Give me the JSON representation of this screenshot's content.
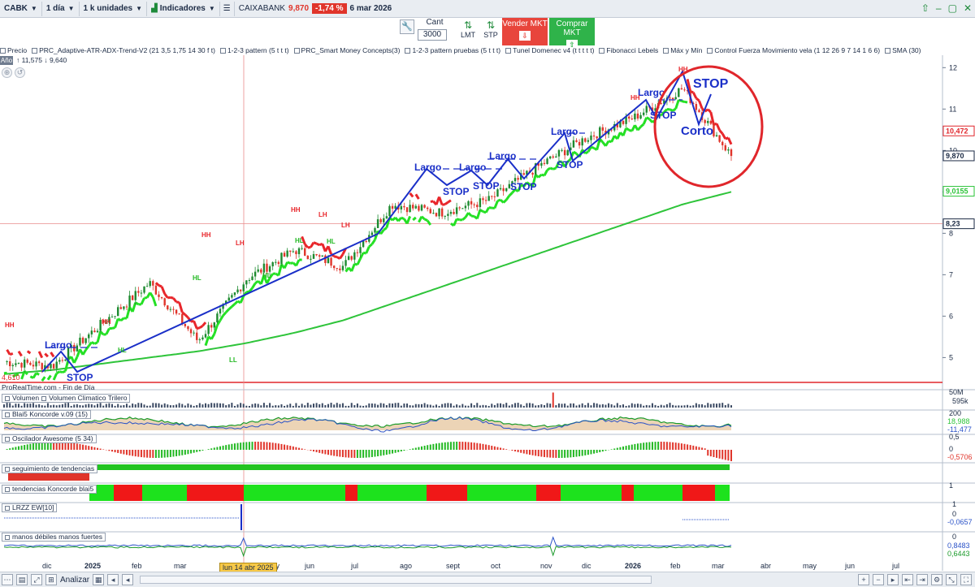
{
  "toolbar": {
    "symbol": "CABK",
    "timeframe": "1 día",
    "units": "1 k unidades",
    "indicators_label": "Indicadores",
    "instrument": "CAIXABANK",
    "last_price": "9,870",
    "change": "-1,74 %",
    "date": "6 mar 2026"
  },
  "order_panel": {
    "qty_label": "Cant",
    "qty_value": "3000",
    "lmt_label": "LMT",
    "stp_label": "STP",
    "sell_label": "Vender MKT",
    "buy_label": "Comprar MKT"
  },
  "indicator_bar": [
    "Precio",
    "PRC_Adaptive-ATR-ADX-Trend-V2 (21 3,5 1,75 14 30 f t)",
    "1-2-3 pattern (5 t t t)",
    "PRC_Smart Money Concepts(3)",
    "1-2-3 pattern pruebas (5 t t t)",
    "Tunel Domenec v4 (t t t t t)",
    "Fibonacci Lebels",
    "Máx y Mín",
    "Control Fuerza Movimiento vela (1 12 26 9 7 14 1 6 6)",
    "SMA (30)"
  ],
  "period_label": "Año",
  "price_range": "↑ 11,575 ↓ 9,640",
  "price_axis": [
    "12",
    "11",
    "10",
    "9",
    "8",
    "7",
    "6",
    "5"
  ],
  "price_tags": {
    "high": "10,472",
    "last": "9,870",
    "sma": "9,0155",
    "fib": "8,23",
    "low_line": "4,610"
  },
  "source_label": "ProRealTime.com - Fin de Día",
  "panels": {
    "volume": {
      "label1": "Volumen",
      "label2": "Volumen Climatico Trilero",
      "axis_top": "50M",
      "value": "595k"
    },
    "koncorde": {
      "label": "Blai5 Koncorde v.09 (15)",
      "axis": [
        "200",
        "18,988",
        "-11,477"
      ]
    },
    "awesome": {
      "label": "Oscilador Awesome (5 34)",
      "axis": [
        "0,5",
        "0",
        "-0,5706"
      ]
    },
    "trend_follow": {
      "label": "seguimiento de tendencias"
    },
    "trend_koncorde": {
      "label": "tendencias Koncorde blai5",
      "axis": [
        "1"
      ]
    },
    "lrzz": {
      "label": "LRZZ EW[10]",
      "axis": [
        "1",
        "0",
        "-0,0657"
      ]
    },
    "weak_strong": {
      "label": "manos débiles  manos fuertes",
      "axis": [
        "0",
        "0,8483",
        "0,6443"
      ]
    }
  },
  "annotations": {
    "largo": "Largo",
    "stop": "STOP",
    "corto": "Corto",
    "hh": "HH",
    "hl": "HL",
    "lh": "LH",
    "ll": "LL"
  },
  "x_axis": [
    "dic",
    "2025",
    "feb",
    "mar",
    "abr",
    "may",
    "jun",
    "jul",
    "ago",
    "sept",
    "oct",
    "nov",
    "dic",
    "2026",
    "feb",
    "mar",
    "abr",
    "may",
    "jun",
    "jul"
  ],
  "date_hover": "lun 14 abr 2025",
  "bottom": {
    "analyze": "Analizar"
  },
  "colors": {
    "bull_candle": "#1d8a2f",
    "bear_candle": "#e0352b",
    "atr_up": "#24e024",
    "atr_down": "#e8262b",
    "sma": "#2ec43a",
    "annotation_blue": "#1a2fc8",
    "circle": "#e0262b"
  },
  "chart_data": {
    "type": "line",
    "title": "CAIXABANK",
    "ylim": [
      4.4,
      12.3
    ],
    "series": [
      {
        "name": "Precio",
        "x": [
          "dic",
          "2025",
          "feb",
          "mar",
          "abr",
          "may",
          "jun",
          "jul",
          "ago",
          "sept",
          "oct",
          "nov",
          "dic",
          "2026",
          "feb",
          "mar"
        ],
        "values": [
          4.9,
          4.8,
          5.8,
          6.8,
          5.4,
          6.9,
          7.6,
          7.2,
          8.7,
          8.5,
          8.8,
          9.6,
          10.3,
          10.8,
          11.5,
          9.87
        ]
      },
      {
        "name": "SMA (30)",
        "x": [
          "dic",
          "2025",
          "feb",
          "mar",
          "abr",
          "may",
          "jun",
          "jul",
          "ago",
          "sept",
          "oct",
          "nov",
          "dic",
          "2026",
          "feb",
          "mar"
        ],
        "values": [
          4.6,
          4.7,
          4.85,
          5.0,
          5.15,
          5.35,
          5.6,
          5.9,
          6.3,
          6.7,
          7.1,
          7.5,
          7.9,
          8.3,
          8.7,
          9.0
        ]
      }
    ]
  }
}
